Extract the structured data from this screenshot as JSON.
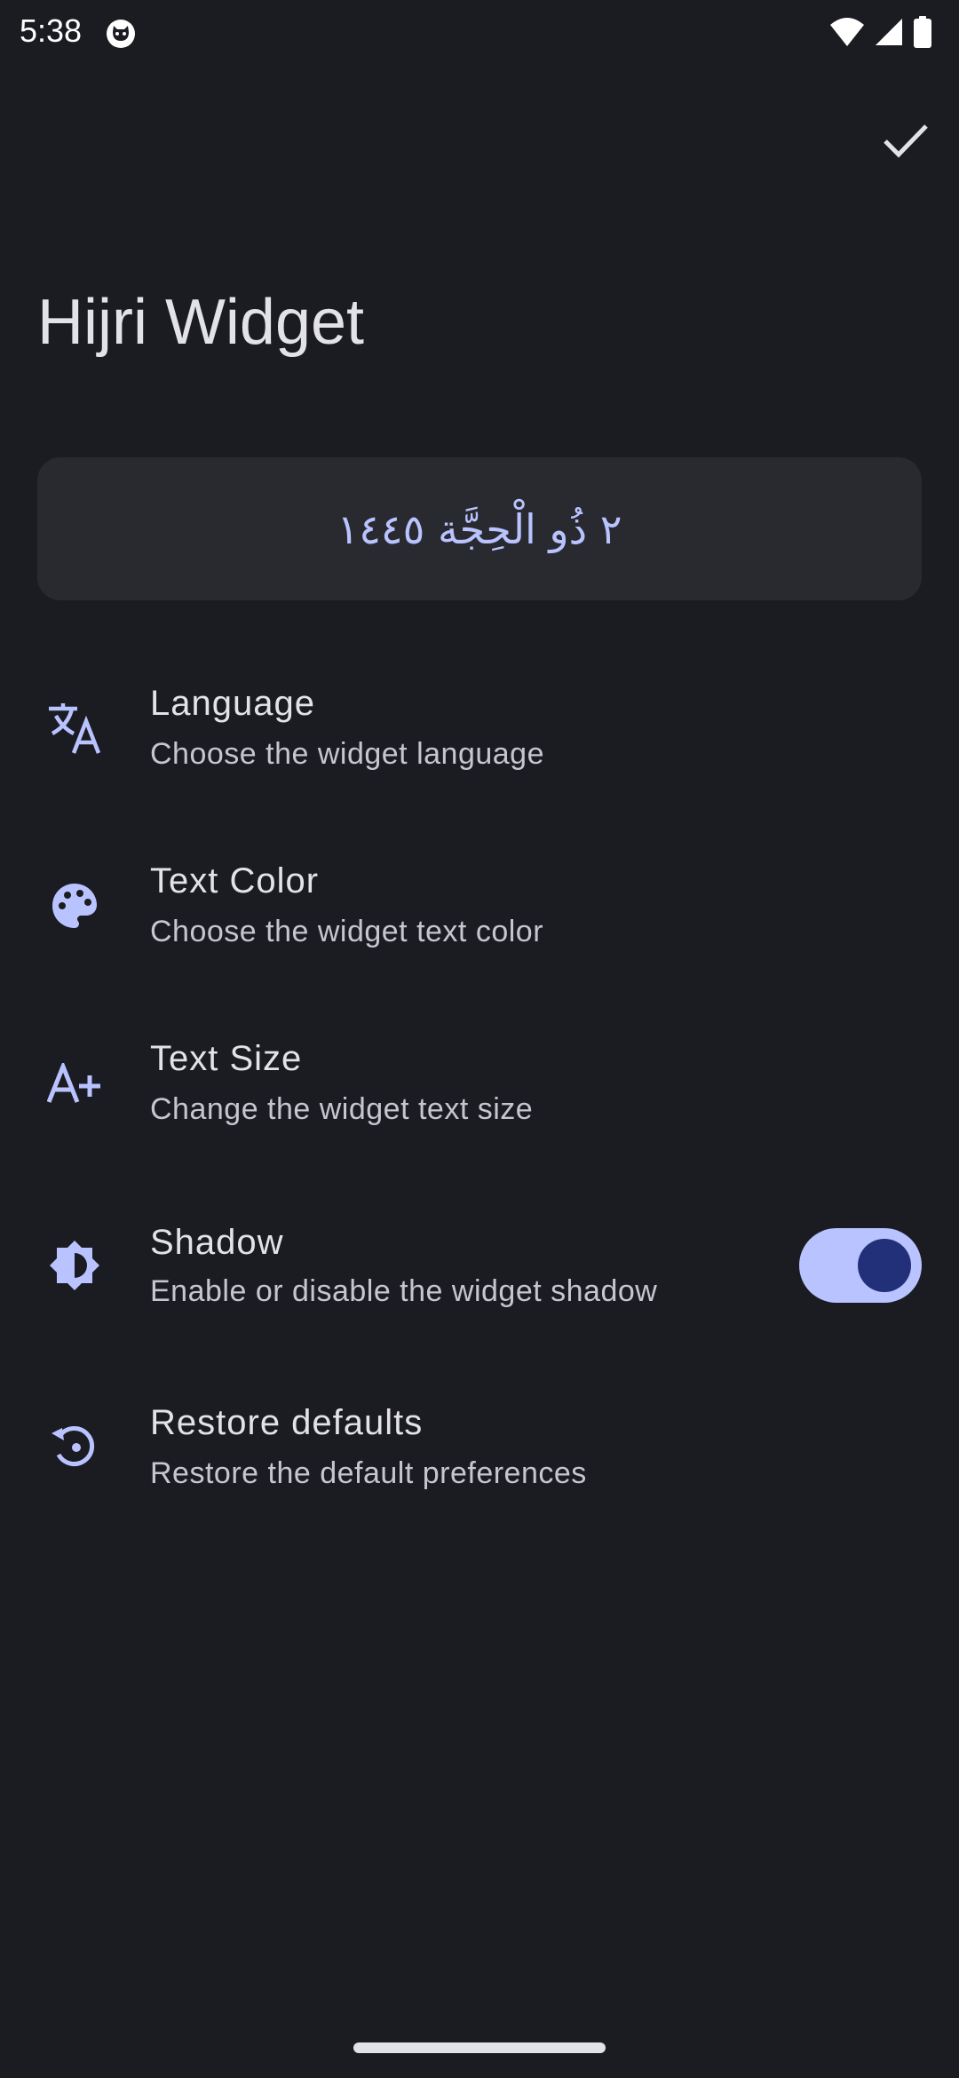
{
  "status_bar": {
    "time": "5:38",
    "icons": [
      "cat-notification-icon",
      "wifi-icon",
      "cellular-signal-icon",
      "battery-icon"
    ]
  },
  "app_bar": {
    "confirm_icon": "check-icon"
  },
  "page": {
    "title": "Hijri Widget"
  },
  "preview": {
    "date_text": "٢ ذُو الْحِجَّة ١٤٤٥"
  },
  "settings": [
    {
      "icon": "translate-icon",
      "title": "Language",
      "subtitle": "Choose the widget language"
    },
    {
      "icon": "palette-icon",
      "title": "Text Color",
      "subtitle": "Choose the widget text color"
    },
    {
      "icon": "text-increase-icon",
      "title": "Text Size",
      "subtitle": "Change the widget text size"
    },
    {
      "icon": "brightness-icon",
      "title": "Shadow",
      "subtitle": "Enable or disable the widget shadow",
      "toggle_on": true
    },
    {
      "icon": "restore-icon",
      "title": "Restore defaults",
      "subtitle": "Restore the default preferences"
    }
  ],
  "colors": {
    "background": "#1b1c21",
    "card": "#292a2f",
    "accent": "#b9c3ff",
    "accent_dark": "#213078",
    "on_surface": "#e3e2e9",
    "on_surface_variant": "#c6c5d0"
  }
}
